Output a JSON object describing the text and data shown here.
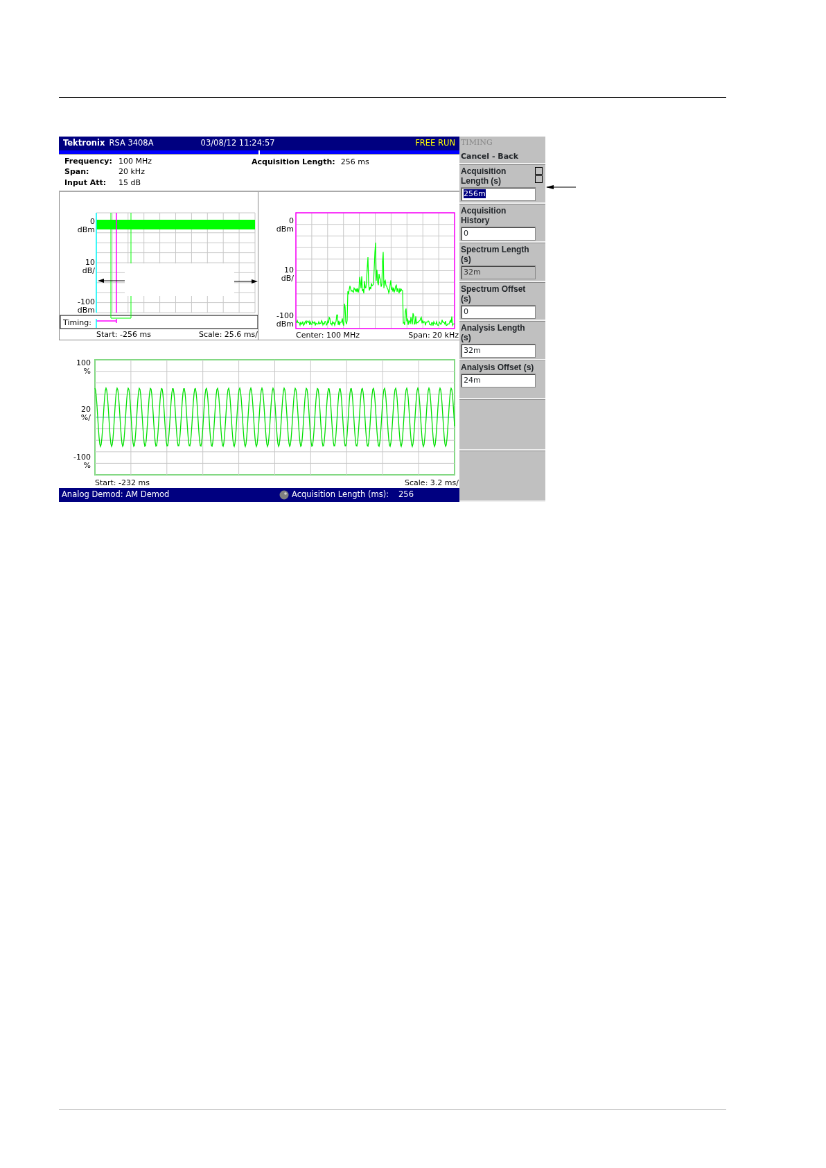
{
  "header": {
    "brand": "Tektronix",
    "model": "RSA 3408A",
    "datetime": "03/08/12 11:24:57",
    "run_status": "FREE RUN"
  },
  "info": [
    {
      "label": "Frequency:",
      "value": "100 MHz"
    },
    {
      "label": "Span:",
      "value": "20 kHz"
    },
    {
      "label": "Input Att:",
      "value": "15 dB"
    }
  ],
  "info_right": {
    "label": "Acquisition Length:",
    "value": "256 ms"
  },
  "overview": {
    "y_labels": [
      {
        "value": "0",
        "unit": "dBm"
      },
      {
        "value": "10",
        "unit": "dB/"
      },
      {
        "value": "-100",
        "unit": "dBm"
      }
    ],
    "timing_label": "Timing:",
    "start": "Start: -256 ms",
    "scale": "Scale: 25.6 ms/"
  },
  "spectrum": {
    "y_labels": [
      {
        "value": "0",
        "unit": "dBm"
      },
      {
        "value": "10",
        "unit": "dB/"
      },
      {
        "value": "-100",
        "unit": "dBm"
      }
    ],
    "center": "Center: 100 MHz",
    "span": "Span: 20 kHz"
  },
  "demod": {
    "y_labels": [
      {
        "value": "100",
        "unit": "%"
      },
      {
        "value": "20",
        "unit": "%/"
      },
      {
        "value": "-100",
        "unit": "%"
      }
    ],
    "start": "Start: -232 ms",
    "scale": "Scale: 3.2 ms/"
  },
  "status_bar": {
    "mode": "Analog Demod: AM Demod",
    "knob_label": "Acquisition Length (ms):",
    "knob_value": "256"
  },
  "menu": {
    "title": "TIMING",
    "title_disabled": true,
    "back": "Cancel - Back",
    "items": [
      {
        "label": "Acquisition Length (s)",
        "value": "256m",
        "selected": true,
        "disabled": false,
        "spinner": true
      },
      {
        "label": "Acquisition History",
        "value": "0",
        "selected": false,
        "disabled": false,
        "spinner": false
      },
      {
        "label": "Spectrum Length (s)",
        "value": "32m",
        "selected": false,
        "disabled": true,
        "spinner": false
      },
      {
        "label": "Spectrum Offset (s)",
        "value": "0",
        "selected": false,
        "disabled": false,
        "spinner": false
      },
      {
        "label": "Analysis Length (s)",
        "value": "32m",
        "selected": false,
        "disabled": false,
        "spinner": false
      },
      {
        "label": "Analysis Offset (s)",
        "value": "24m",
        "selected": false,
        "disabled": false,
        "spinner": false
      }
    ]
  }
}
